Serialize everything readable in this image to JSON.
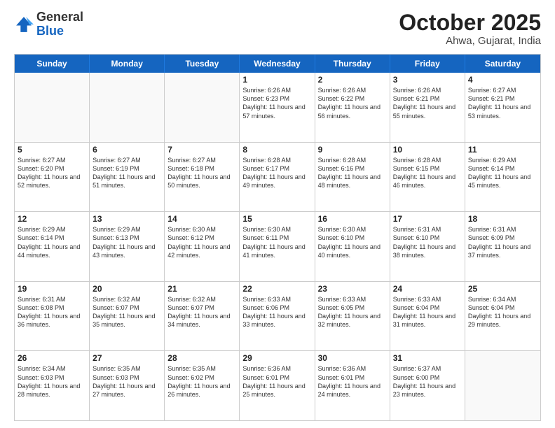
{
  "header": {
    "logo_general": "General",
    "logo_blue": "Blue",
    "month_title": "October 2025",
    "subtitle": "Ahwa, Gujarat, India"
  },
  "day_headers": [
    "Sunday",
    "Monday",
    "Tuesday",
    "Wednesday",
    "Thursday",
    "Friday",
    "Saturday"
  ],
  "weeks": [
    [
      {
        "day": "",
        "empty": true
      },
      {
        "day": "",
        "empty": true
      },
      {
        "day": "",
        "empty": true
      },
      {
        "day": "1",
        "sunrise": "6:26 AM",
        "sunset": "6:23 PM",
        "daylight": "11 hours and 57 minutes."
      },
      {
        "day": "2",
        "sunrise": "6:26 AM",
        "sunset": "6:22 PM",
        "daylight": "11 hours and 56 minutes."
      },
      {
        "day": "3",
        "sunrise": "6:26 AM",
        "sunset": "6:21 PM",
        "daylight": "11 hours and 55 minutes."
      },
      {
        "day": "4",
        "sunrise": "6:27 AM",
        "sunset": "6:21 PM",
        "daylight": "11 hours and 53 minutes."
      }
    ],
    [
      {
        "day": "5",
        "sunrise": "6:27 AM",
        "sunset": "6:20 PM",
        "daylight": "11 hours and 52 minutes."
      },
      {
        "day": "6",
        "sunrise": "6:27 AM",
        "sunset": "6:19 PM",
        "daylight": "11 hours and 51 minutes."
      },
      {
        "day": "7",
        "sunrise": "6:27 AM",
        "sunset": "6:18 PM",
        "daylight": "11 hours and 50 minutes."
      },
      {
        "day": "8",
        "sunrise": "6:28 AM",
        "sunset": "6:17 PM",
        "daylight": "11 hours and 49 minutes."
      },
      {
        "day": "9",
        "sunrise": "6:28 AM",
        "sunset": "6:16 PM",
        "daylight": "11 hours and 48 minutes."
      },
      {
        "day": "10",
        "sunrise": "6:28 AM",
        "sunset": "6:15 PM",
        "daylight": "11 hours and 46 minutes."
      },
      {
        "day": "11",
        "sunrise": "6:29 AM",
        "sunset": "6:14 PM",
        "daylight": "11 hours and 45 minutes."
      }
    ],
    [
      {
        "day": "12",
        "sunrise": "6:29 AM",
        "sunset": "6:14 PM",
        "daylight": "11 hours and 44 minutes."
      },
      {
        "day": "13",
        "sunrise": "6:29 AM",
        "sunset": "6:13 PM",
        "daylight": "11 hours and 43 minutes."
      },
      {
        "day": "14",
        "sunrise": "6:30 AM",
        "sunset": "6:12 PM",
        "daylight": "11 hours and 42 minutes."
      },
      {
        "day": "15",
        "sunrise": "6:30 AM",
        "sunset": "6:11 PM",
        "daylight": "11 hours and 41 minutes."
      },
      {
        "day": "16",
        "sunrise": "6:30 AM",
        "sunset": "6:10 PM",
        "daylight": "11 hours and 40 minutes."
      },
      {
        "day": "17",
        "sunrise": "6:31 AM",
        "sunset": "6:10 PM",
        "daylight": "11 hours and 38 minutes."
      },
      {
        "day": "18",
        "sunrise": "6:31 AM",
        "sunset": "6:09 PM",
        "daylight": "11 hours and 37 minutes."
      }
    ],
    [
      {
        "day": "19",
        "sunrise": "6:31 AM",
        "sunset": "6:08 PM",
        "daylight": "11 hours and 36 minutes."
      },
      {
        "day": "20",
        "sunrise": "6:32 AM",
        "sunset": "6:07 PM",
        "daylight": "11 hours and 35 minutes."
      },
      {
        "day": "21",
        "sunrise": "6:32 AM",
        "sunset": "6:07 PM",
        "daylight": "11 hours and 34 minutes."
      },
      {
        "day": "22",
        "sunrise": "6:33 AM",
        "sunset": "6:06 PM",
        "daylight": "11 hours and 33 minutes."
      },
      {
        "day": "23",
        "sunrise": "6:33 AM",
        "sunset": "6:05 PM",
        "daylight": "11 hours and 32 minutes."
      },
      {
        "day": "24",
        "sunrise": "6:33 AM",
        "sunset": "6:04 PM",
        "daylight": "11 hours and 31 minutes."
      },
      {
        "day": "25",
        "sunrise": "6:34 AM",
        "sunset": "6:04 PM",
        "daylight": "11 hours and 29 minutes."
      }
    ],
    [
      {
        "day": "26",
        "sunrise": "6:34 AM",
        "sunset": "6:03 PM",
        "daylight": "11 hours and 28 minutes."
      },
      {
        "day": "27",
        "sunrise": "6:35 AM",
        "sunset": "6:03 PM",
        "daylight": "11 hours and 27 minutes."
      },
      {
        "day": "28",
        "sunrise": "6:35 AM",
        "sunset": "6:02 PM",
        "daylight": "11 hours and 26 minutes."
      },
      {
        "day": "29",
        "sunrise": "6:36 AM",
        "sunset": "6:01 PM",
        "daylight": "11 hours and 25 minutes."
      },
      {
        "day": "30",
        "sunrise": "6:36 AM",
        "sunset": "6:01 PM",
        "daylight": "11 hours and 24 minutes."
      },
      {
        "day": "31",
        "sunrise": "6:37 AM",
        "sunset": "6:00 PM",
        "daylight": "11 hours and 23 minutes."
      },
      {
        "day": "",
        "empty": true
      }
    ]
  ]
}
